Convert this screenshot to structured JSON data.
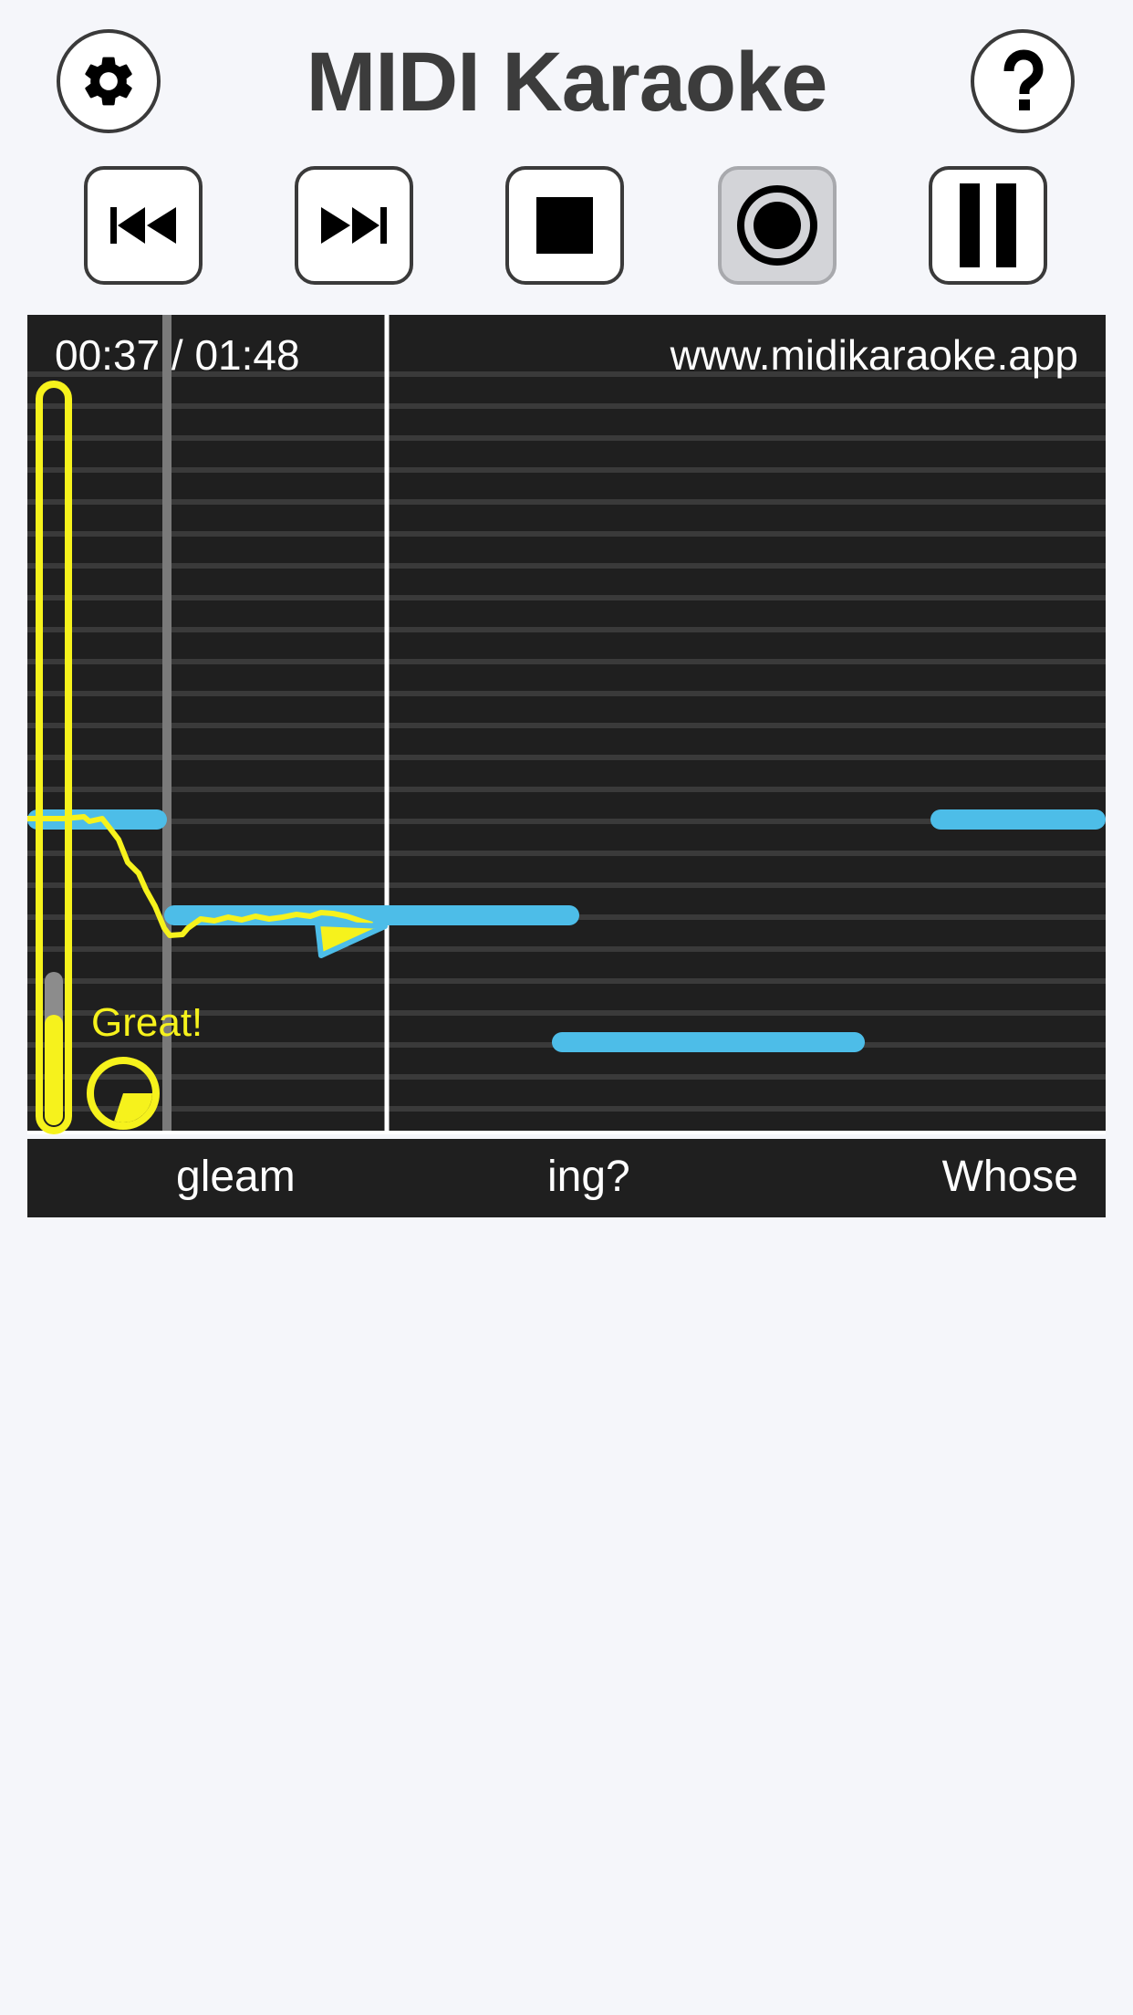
{
  "header": {
    "title": "MIDI Karaoke",
    "settings_icon": "gear-icon",
    "help_icon": "question-mark-icon"
  },
  "transport": {
    "buttons": [
      {
        "name": "skip-back",
        "icon": "skip-back-icon",
        "active": false
      },
      {
        "name": "skip-forward",
        "icon": "skip-forward-icon",
        "active": false
      },
      {
        "name": "stop",
        "icon": "stop-icon",
        "active": false
      },
      {
        "name": "record",
        "icon": "record-icon",
        "active": true
      },
      {
        "name": "pause",
        "icon": "pause-icon",
        "active": false
      }
    ]
  },
  "player": {
    "elapsed": "00:37",
    "duration": "01:48",
    "time_readout": "00:37 / 01:48",
    "site_url": "www.midikaraoke.app",
    "feedback": "Great!",
    "volume_level": 0.15,
    "accuracy_pie_fraction": 0.3
  },
  "lyrics": {
    "words": [
      "gleam",
      "ing?",
      "Whose"
    ]
  },
  "colors": {
    "background": "#f5f6fa",
    "stage": "#1f1f1f",
    "note": "#4dbde8",
    "pitch_trace": "#f6f21c",
    "button_border": "#3a3a3a",
    "active_button": "#d3d4d8"
  }
}
